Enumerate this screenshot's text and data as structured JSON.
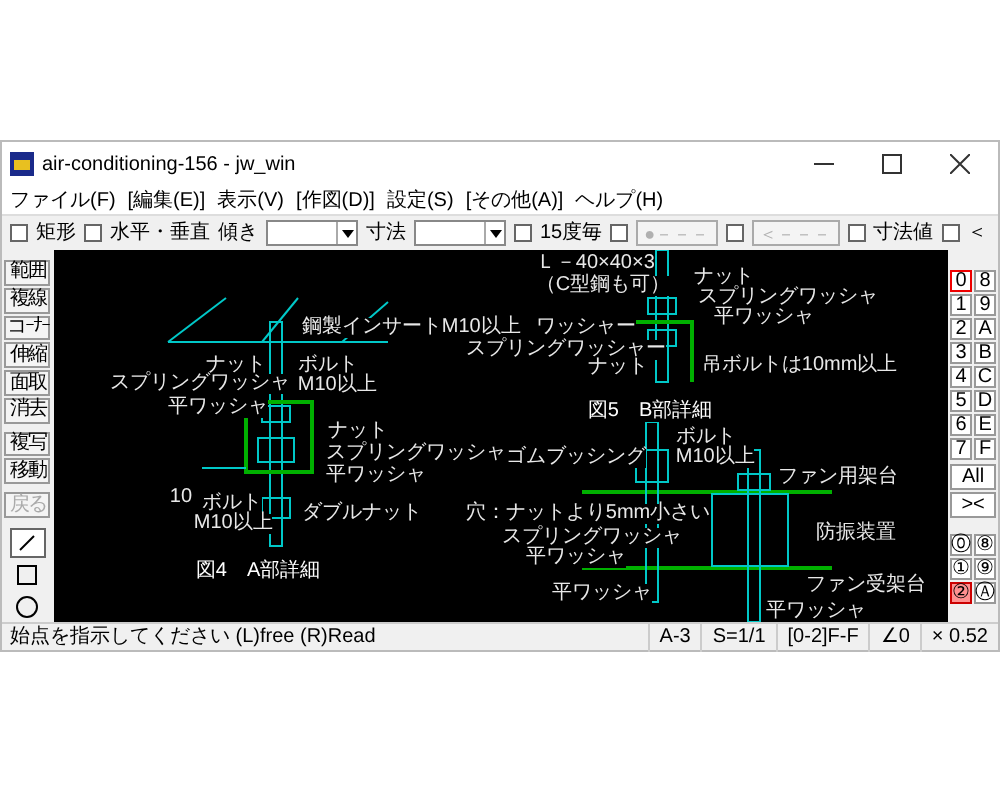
{
  "window": {
    "title": "air-conditioning-156 - jw_win"
  },
  "menu": [
    "ファイル(F)",
    "[編集(E)]",
    "表示(V)",
    "[作図(D)]",
    "設定(S)",
    "[その他(A)]",
    "ヘルプ(H)"
  ],
  "toolbar": [
    {
      "kind": "checkbox",
      "label": "矩形",
      "checked": false
    },
    {
      "kind": "checkbox",
      "label": "水平・垂直",
      "checked": false
    },
    {
      "kind": "combo",
      "label": "傾き"
    },
    {
      "kind": "combo",
      "label": "寸法"
    },
    {
      "kind": "checkbox",
      "label": "15度毎",
      "checked": false
    },
    {
      "kind": "checkbutton",
      "button": "●－－－",
      "checked": false,
      "disabled": true
    },
    {
      "kind": "checkbutton",
      "button": "＜－－－",
      "checked": false,
      "disabled": true
    },
    {
      "kind": "checkbox",
      "label": "寸法値",
      "checked": false
    },
    {
      "kind": "checkbox",
      "label": "＜",
      "checked": false
    }
  ],
  "left_tools": [
    {
      "label": "範囲",
      "disabled": false
    },
    {
      "label": "複線",
      "disabled": false
    },
    {
      "label": "コｰﾅｰ",
      "disabled": false
    },
    {
      "label": "伸縮",
      "disabled": false
    },
    {
      "label": "面取",
      "disabled": false
    },
    {
      "label": "消去",
      "disabled": false
    },
    {
      "label": "複写",
      "disabled": false
    },
    {
      "label": "移動",
      "disabled": false
    },
    {
      "label": "戻る",
      "disabled": true
    }
  ],
  "draw_tools": [
    {
      "kind": "line",
      "selected": true
    },
    {
      "kind": "rect",
      "selected": false
    },
    {
      "kind": "circle",
      "selected": false
    }
  ],
  "canvas_labels": [
    "鋼製インサートM10以上",
    "ナット",
    "ボルト",
    "スプリングワッシャ",
    "M10以上",
    "平ワッシャ",
    "ナット",
    "スプリングワッシャ",
    "平ワッシャ",
    "10",
    "ボルト",
    "M10以上",
    "ダブルナット",
    "図4　A部詳細",
    "Ｌ－40×40×3",
    "（C型鋼も可）",
    "ナット",
    "スプリングワッシャ",
    "平ワッシャ",
    "ワッシャー",
    "スプリングワッシャー",
    "ナット",
    "吊ボルトは10mm以上",
    "図5　B部詳細",
    "ボルト",
    "ゴムブッシング",
    "M10以上",
    "ファン用架台",
    "穴：ナットより5mm小さい",
    "スプリングワッシャ",
    "平ワッシャ",
    "防振装置",
    "平ワッシャ",
    "ファン受架台",
    "平ワッシャ"
  ],
  "layers": [
    {
      "label": "0",
      "selected": true
    },
    {
      "label": "8",
      "selected": false
    },
    {
      "label": "1",
      "selected": false
    },
    {
      "label": "9",
      "selected": false
    },
    {
      "label": "2",
      "selected": false
    },
    {
      "label": "A",
      "selected": false
    },
    {
      "label": "3",
      "selected": false
    },
    {
      "label": "B",
      "selected": false
    },
    {
      "label": "4",
      "selected": false
    },
    {
      "label": "C",
      "selected": false
    },
    {
      "label": "5",
      "selected": false
    },
    {
      "label": "D",
      "selected": false
    },
    {
      "label": "6",
      "selected": false
    },
    {
      "label": "E",
      "selected": false
    },
    {
      "label": "7",
      "selected": false
    },
    {
      "label": "F",
      "selected": false
    }
  ],
  "all_button": "All",
  "swap_button": "><",
  "layer_groups": [
    {
      "label": "⓪",
      "selected": false
    },
    {
      "label": "⑧",
      "selected": false
    },
    {
      "label": "①",
      "selected": false
    },
    {
      "label": "⑨",
      "selected": false
    },
    {
      "label": "②",
      "selected": true
    },
    {
      "label": "Ⓐ",
      "selected": false
    }
  ],
  "status_bar": {
    "message": "始点を指示してください (L)free (R)Read",
    "fields": [
      "A-3",
      "S=1/1",
      "[0-2]F-F",
      "∠0",
      "× 0.52"
    ]
  }
}
